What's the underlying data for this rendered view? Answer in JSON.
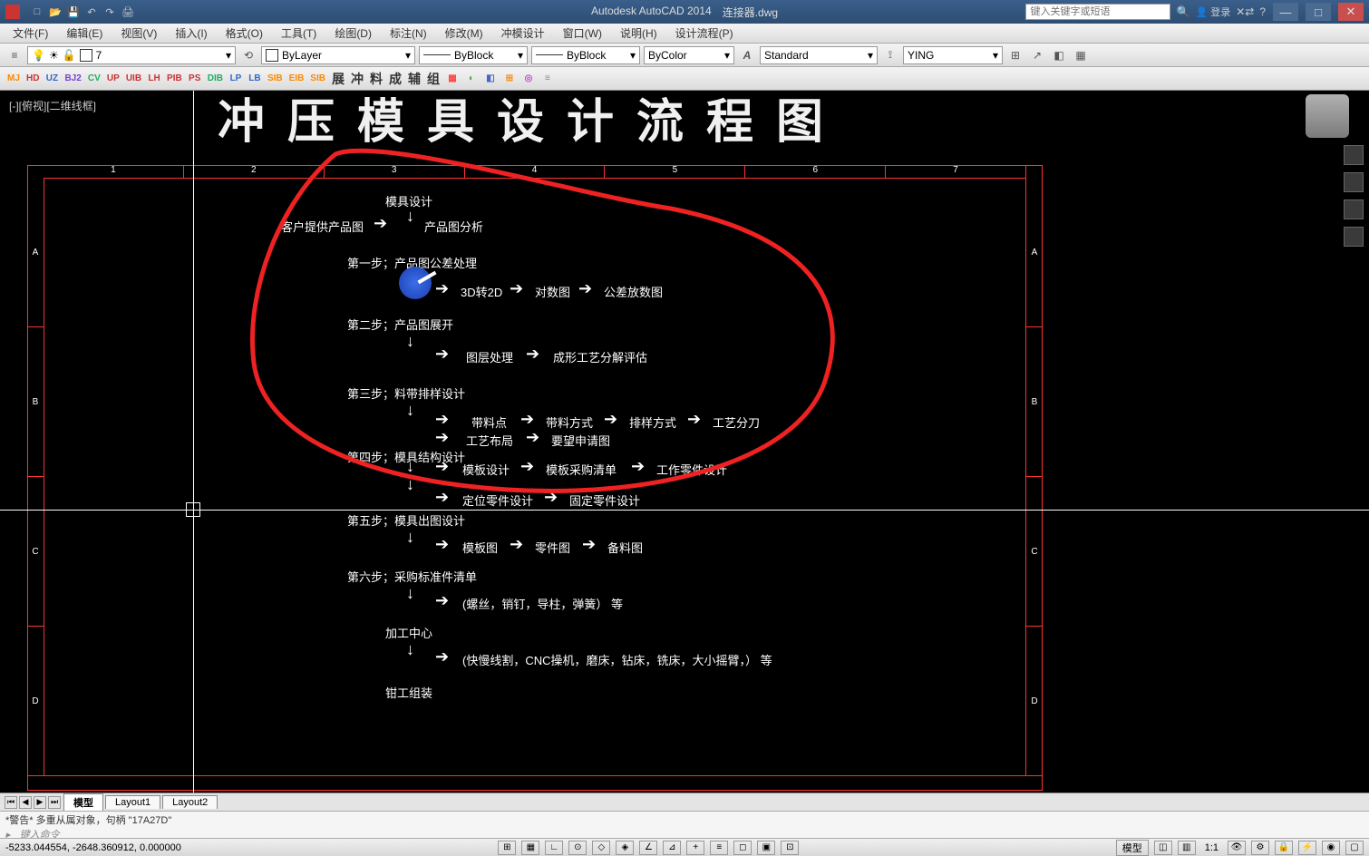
{
  "app": {
    "name": "Autodesk AutoCAD 2014",
    "doc": "连接器.dwg"
  },
  "search": {
    "placeholder": "键入关键字或短语"
  },
  "user": {
    "label": "登录"
  },
  "menu": [
    "文件(F)",
    "编辑(E)",
    "视图(V)",
    "插入(I)",
    "格式(O)",
    "工具(T)",
    "绘图(D)",
    "标注(N)",
    "修改(M)",
    "冲模设计",
    "窗口(W)",
    "说明(H)",
    "设计流程(P)"
  ],
  "props": {
    "layer_value": "7",
    "linetype1": "ByLayer",
    "linetype2": "ByBlock",
    "lineweight": "ByBlock",
    "color": "ByColor",
    "textstyle": "Standard",
    "dimstyle": "YING"
  },
  "ribbon": [
    "MJ",
    "HD",
    "UZ",
    "BJ2",
    "CV",
    "UP",
    "UIB",
    "LH",
    "PIB",
    "PS",
    "DIB",
    "LP",
    "LB",
    "SIB",
    "EIB",
    "SIB",
    "展",
    "冲",
    "料",
    "成",
    "辅",
    "组"
  ],
  "viewlabel": "[-][俯视][二维线框]",
  "big_title": "冲 压 模 具 设 计 流 程 图",
  "ruler_top": [
    "1",
    "2",
    "3",
    "4",
    "5",
    "6",
    "7"
  ],
  "ruler_side": [
    "A",
    "B",
    "C",
    "D"
  ],
  "flow": {
    "n0": "模具设计",
    "n1a": "客户提供产品图",
    "n1b": "产品图分析",
    "s1": "第一步；产品图公差处理",
    "s1a": "3D转2D",
    "s1b": "对数图",
    "s1c": "公差放数图",
    "s2": "第二步；产品图展开",
    "s2a": "图层处理",
    "s2b": "成形工艺分解评估",
    "s3": "第三步；料带排样设计",
    "s3a": "带料点",
    "s3b": "带料方式",
    "s3c": "排样方式",
    "s3d": "工艺分刀",
    "s3e": "工艺布局",
    "s3f": "要望申请图",
    "s4": "第四步；模具结构设计",
    "s4a": "模板设计",
    "s4b": "模板采购清单",
    "s4c": "工作零件设计",
    "s4d": "定位零件设计",
    "s4e": "固定零件设计",
    "s5": "第五步；模具出图设计",
    "s5a": "模板图",
    "s5b": "零件图",
    "s5c": "备料图",
    "s6": "第六步；采购标准件清单",
    "s6a": "(螺丝，销钉，导柱，弹簧）  等",
    "s7": "加工中心",
    "s7a": "(快慢线割，CNC操机，磨床，钻床，铣床，大小摇臂，）  等",
    "s8": "钳工组装"
  },
  "tabs": {
    "model": "模型",
    "layout1": "Layout1",
    "layout2": "Layout2"
  },
  "cmd": {
    "history": "*警告* 多重从属对象，句柄 \"17A27D\"",
    "prompt": "键入命令"
  },
  "status": {
    "coords": "-5233.044554, -2648.360912, 0.000000",
    "modeltxt": "模型",
    "scale": "1:1"
  }
}
